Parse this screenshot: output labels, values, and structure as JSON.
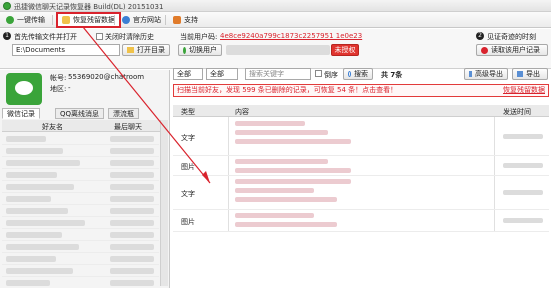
{
  "window": {
    "title": "迅捷微信聊天记录恢复器 Build(DL) 20151031"
  },
  "toolbar": {
    "items": [
      {
        "label": "一键传输"
      },
      {
        "label": "恢复残留数据"
      },
      {
        "label": "官方网站"
      },
      {
        "label": "支持"
      }
    ]
  },
  "step1": {
    "num": "1",
    "label": "首先传输文件并打开",
    "checkbox_label": "关闭时清除历史",
    "path_value": "E:\\Documents",
    "open_button": "打开目录"
  },
  "current_user": {
    "label": "当前用户码:",
    "code": "4e8ce9240a799c1873c2257951 1e0e23",
    "switch_button": "切换用户",
    "unauth_badge": "未授权"
  },
  "step2": {
    "num": "2",
    "label": "见证奇迹的时刻",
    "read_button": "读取该用户记录"
  },
  "profile": {
    "account_label": "帐号:",
    "account_value": "55369020@chatroom",
    "region_label": "地区:",
    "region_value": "-"
  },
  "left_tabs": [
    {
      "label": "微信记录"
    },
    {
      "label": "QQ离线消息"
    },
    {
      "label": "漂流瓶"
    }
  ],
  "friend_table": {
    "col_name": "好友名",
    "col_last": "最后聊天",
    "rows": [
      "",
      "",
      "",
      "",
      "",
      "",
      "",
      "",
      "",
      "",
      "",
      "",
      ""
    ]
  },
  "filter": {
    "select1": "全部",
    "select2": "全部",
    "search_placeholder": "搜索关键字",
    "reverse_label": "倒序",
    "search_button": "搜索",
    "total": "共 7条",
    "advanced_export": "高级导出",
    "export": "导出"
  },
  "warning": {
    "text": "扫描当前好友，发现 599 条已删除的记录，可恢复 54 条！点击查看！",
    "link": "恢复残留数据"
  },
  "msg_table": {
    "col_type": "类型",
    "col_content": "内容",
    "col_time": "发送时间",
    "rows": [
      {
        "type": "文字"
      },
      {
        "type": "图片"
      },
      {
        "type": "文字"
      },
      {
        "type": "图片"
      }
    ]
  },
  "colors": {
    "accent_red": "#d9232d",
    "brand_green": "#3aa43a"
  }
}
